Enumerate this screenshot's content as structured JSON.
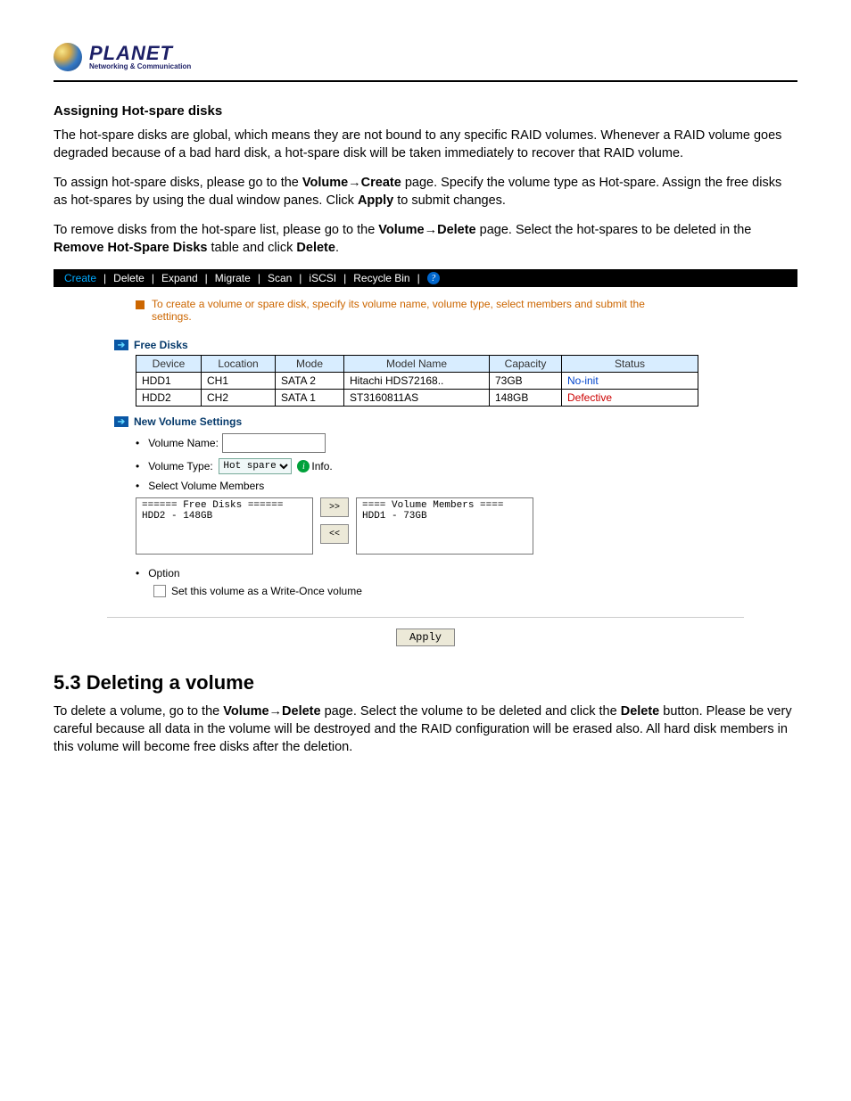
{
  "logo": {
    "name": "PLANET",
    "tag": "Networking & Communication"
  },
  "sec1_title": "Assigning Hot-spare disks",
  "p1": "The hot-spare disks are global, which means they are not bound to any specific RAID volumes. Whenever a RAID volume goes degraded because of a bad hard disk, a hot-spare disk will be taken immediately to recover that RAID volume.",
  "p2a": "To assign hot-spare disks, please go to the ",
  "p2b": "Volume→Create",
  "p2c": " page. Specify the volume type as Hot-spare. Assign the free disks as hot-spares by using the dual window panes. Click ",
  "p2d": "Apply",
  "p2e": " to submit changes.",
  "p3a": "To remove disks from the hot-spare list, please go to the ",
  "p3b": "Volume→Delete",
  "p3c": " page. Select the hot-spares to be deleted in the ",
  "p3d": "Remove Hot-Spare Disks",
  "p3e": " table and click ",
  "p3f": "Delete",
  "p3g": ".",
  "nav": [
    "Create",
    "Delete",
    "Expand",
    "Migrate",
    "Scan",
    "iSCSI",
    "Recycle Bin"
  ],
  "hint": "To create a volume or spare disk, specify its volume name, volume type, select members and submit the settings.",
  "fd_title": "Free Disks",
  "fd_head": [
    "Device",
    "Location",
    "Mode",
    "Model Name",
    "Capacity",
    "Status"
  ],
  "fd_rows": [
    [
      "HDD1",
      "CH1",
      "SATA 2",
      "Hitachi HDS72168..",
      "73GB",
      "No-init"
    ],
    [
      "HDD2",
      "CH2",
      "SATA 1",
      "ST3160811AS",
      "148GB",
      "Defective"
    ]
  ],
  "nv_title": "New Volume Settings",
  "vname_lbl": "Volume Name:",
  "vtype_lbl": "Volume Type:",
  "vtype_val": "Hot spare",
  "info_lbl": "Info.",
  "svm_lbl": "Select Volume Members",
  "free_box_hdr": "====== Free Disks ======",
  "free_box_row": "HDD2 - 148GB",
  "mem_box_hdr": "==== Volume Members ====",
  "mem_box_row": "HDD1 - 73GB",
  "move_r": ">>",
  "move_l": "<<",
  "opt_lbl": "Option",
  "wo_lbl": "Set this volume as a Write-Once volume",
  "apply_lbl": "Apply",
  "h2": "5.3 Deleting a volume",
  "p4a": "To delete a volume, go to the ",
  "p4b": "Volume→Delete",
  "p4c": " page. Select the volume to be deleted and click the ",
  "p4d": "Delete",
  "p4e": " button. Please be very careful because all data in the volume will be destroyed and the RAID configuration will be erased also. All hard disk members in this volume will become free disks after the deletion."
}
